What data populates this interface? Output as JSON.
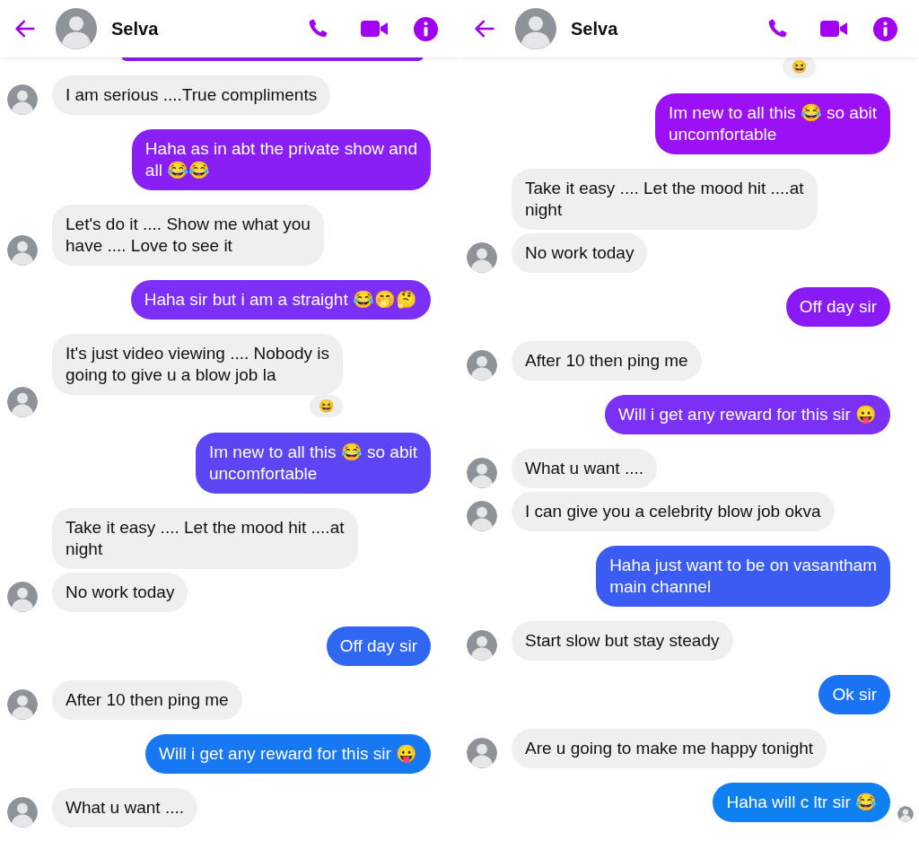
{
  "panels": [
    {
      "header": {
        "title": "Selva"
      },
      "messages": [
        {
          "kind": "clipped",
          "color": "#8a1ff5"
        },
        {
          "kind": "incoming",
          "lines": [
            "I am serious ....True compliments"
          ],
          "avatar": true
        },
        {
          "kind": "outgoing",
          "lines": [
            "Haha as in abt the private show and",
            "all 😂😂"
          ],
          "color": "#8a1ff5",
          "seen": false
        },
        {
          "kind": "incoming",
          "lines": [
            "Let's do it .... Show me what you",
            "have .... Love to see it"
          ],
          "avatar": true
        },
        {
          "kind": "outgoing",
          "lines": [
            "Haha sir but i am a straight 😂🤭🤔"
          ],
          "color": "#7b2ff7",
          "seen": false
        },
        {
          "kind": "incoming",
          "lines": [
            "It's just video viewing .... Nobody is",
            "going to give u a blow job la"
          ],
          "avatar": true,
          "reaction": "😆"
        },
        {
          "kind": "outgoing",
          "lines": [
            "Im new to all this 😂 so abit",
            "uncomfortable"
          ],
          "color": "#5b45f5",
          "seen": false
        },
        {
          "kind": "incoming",
          "lines": [
            "Take it easy .... Let the mood hit ....at",
            "night"
          ],
          "avatar": false
        },
        {
          "kind": "incoming",
          "lines": [
            "No work today"
          ],
          "avatar": true
        },
        {
          "kind": "outgoing",
          "lines": [
            "Off day sir"
          ],
          "color": "#2f66f2",
          "seen": false
        },
        {
          "kind": "incoming",
          "lines": [
            "After 10 then ping me"
          ],
          "avatar": true
        },
        {
          "kind": "outgoing",
          "lines": [
            "Will i get any reward for this sir 😛"
          ],
          "color": "#1877f2",
          "seen": false
        },
        {
          "kind": "incoming",
          "lines": [
            "What u want ...."
          ],
          "avatar": true
        }
      ]
    },
    {
      "header": {
        "title": "Selva"
      },
      "messages": [
        {
          "kind": "reaction",
          "text": "😆"
        },
        {
          "kind": "outgoing",
          "lines": [
            "Im new to all this 😂 so abit",
            "uncomfortable"
          ],
          "color": "#9b10f5",
          "seen": false
        },
        {
          "kind": "incoming",
          "lines": [
            "Take it easy .... Let the mood hit ....at",
            "night"
          ],
          "avatar": false
        },
        {
          "kind": "incoming",
          "lines": [
            "No work today"
          ],
          "avatar": true
        },
        {
          "kind": "outgoing",
          "lines": [
            "Off day sir"
          ],
          "color": "#8a1af5",
          "seen": false
        },
        {
          "kind": "incoming",
          "lines": [
            "After 10 then ping me"
          ],
          "avatar": true
        },
        {
          "kind": "outgoing",
          "lines": [
            "Will i get any reward for this sir 😛"
          ],
          "color": "#7b30f5",
          "seen": false
        },
        {
          "kind": "incoming",
          "lines": [
            "What u want ...."
          ],
          "avatar": true
        },
        {
          "kind": "incoming",
          "lines": [
            "I can give you a celebrity blow job okva"
          ],
          "avatar": true
        },
        {
          "kind": "outgoing",
          "lines": [
            "Haha just want to be on vasantham",
            "main channel"
          ],
          "color": "#3a5cf2",
          "seen": false
        },
        {
          "kind": "incoming",
          "lines": [
            "Start slow but stay steady"
          ],
          "avatar": true
        },
        {
          "kind": "outgoing",
          "lines": [
            "Ok sir"
          ],
          "color": "#1a73f2",
          "seen": false
        },
        {
          "kind": "incoming",
          "lines": [
            "Are u going to make me happy tonight"
          ],
          "avatar": true
        },
        {
          "kind": "outgoing",
          "lines": [
            "Haha will c ltr sir 😂"
          ],
          "color": "#0f80f2",
          "seen": true
        }
      ]
    }
  ]
}
